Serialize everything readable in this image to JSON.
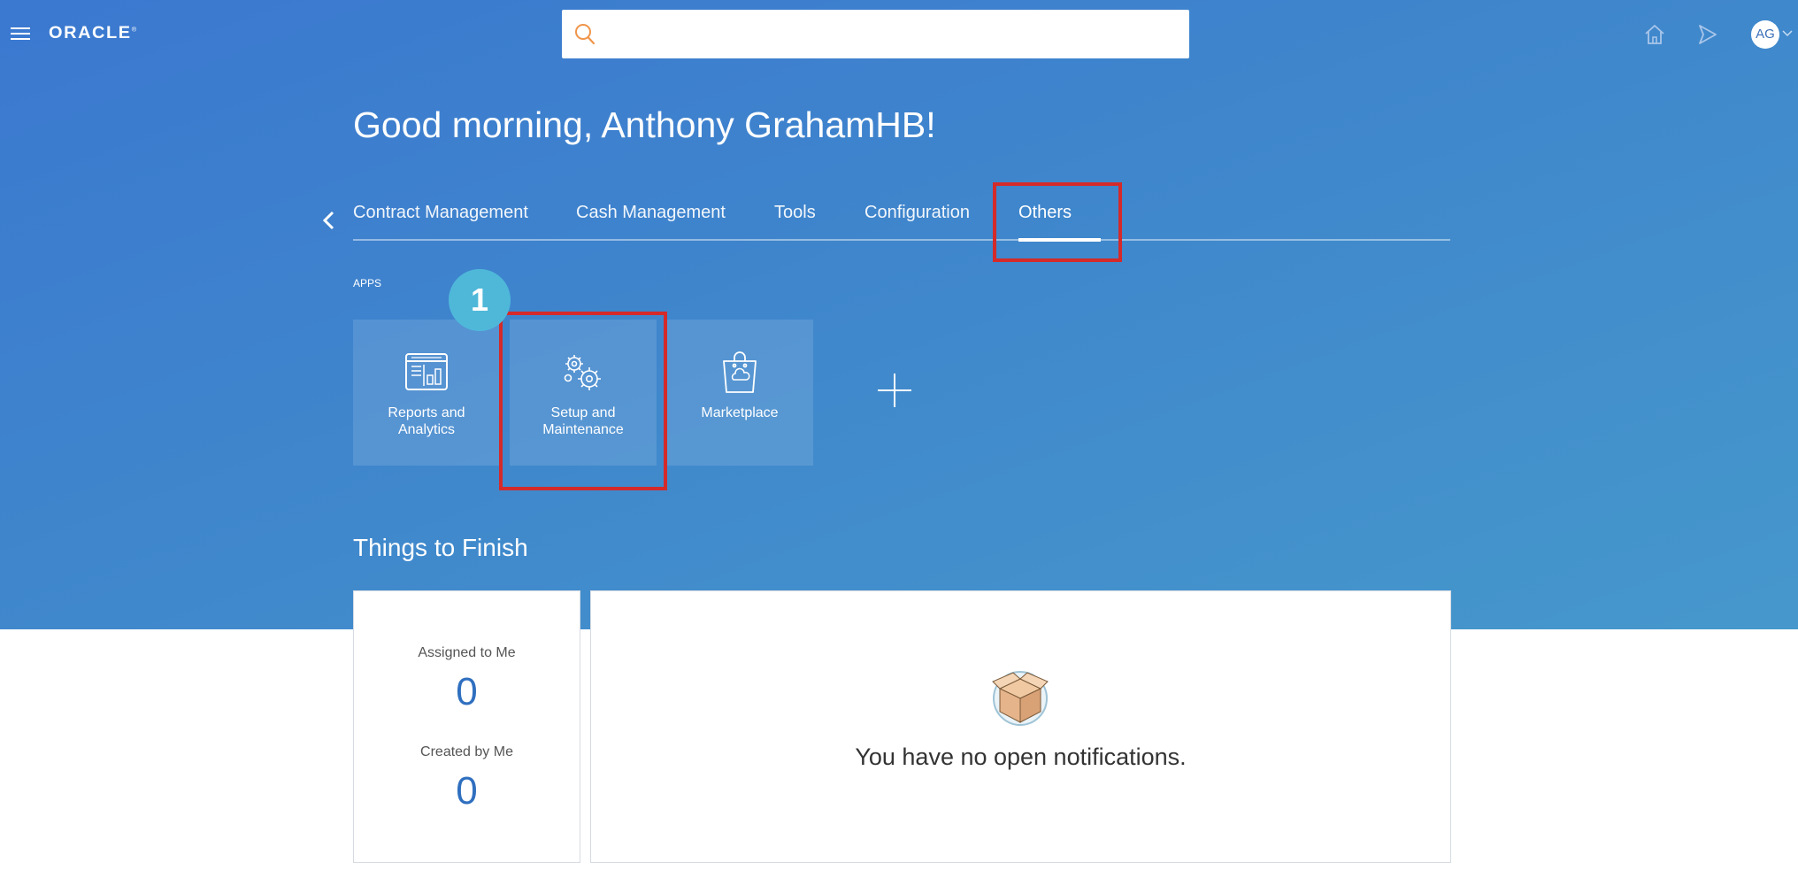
{
  "header": {
    "logo_text": "ORACLE",
    "search": {
      "value": "",
      "placeholder": ""
    },
    "icons": [
      "menu-icon",
      "home-icon",
      "navigator-icon"
    ],
    "avatar_initials": "AG"
  },
  "greeting": "Good morning, Anthony GrahamHB!",
  "tabs": [
    {
      "label": "Contract Management",
      "selected": false
    },
    {
      "label": "Cash Management",
      "selected": false
    },
    {
      "label": "Tools",
      "selected": false
    },
    {
      "label": "Configuration",
      "selected": false
    },
    {
      "label": "Others",
      "selected": true
    }
  ],
  "apps": {
    "section_label": "APPS",
    "tiles": [
      {
        "label": "Reports and Analytics",
        "icon": "reports-icon"
      },
      {
        "label": "Setup and Maintenance",
        "icon": "gears-icon"
      },
      {
        "label": "Marketplace",
        "icon": "marketplace-bag-icon"
      }
    ]
  },
  "annotation": {
    "step_number": "1"
  },
  "things_to_finish": {
    "title": "Things to Finish",
    "assigned_label": "Assigned to Me",
    "assigned_count": "0",
    "created_label": "Created by Me",
    "created_count": "0"
  },
  "notifications": {
    "empty_message": "You have no open notifications."
  },
  "colors": {
    "hero_gradient_start": "#3b78d0",
    "hero_gradient_end": "#4698cc",
    "highlight_red": "#d42a2a",
    "badge_cyan": "#4fb8d9",
    "count_blue": "#2f6fbf"
  }
}
